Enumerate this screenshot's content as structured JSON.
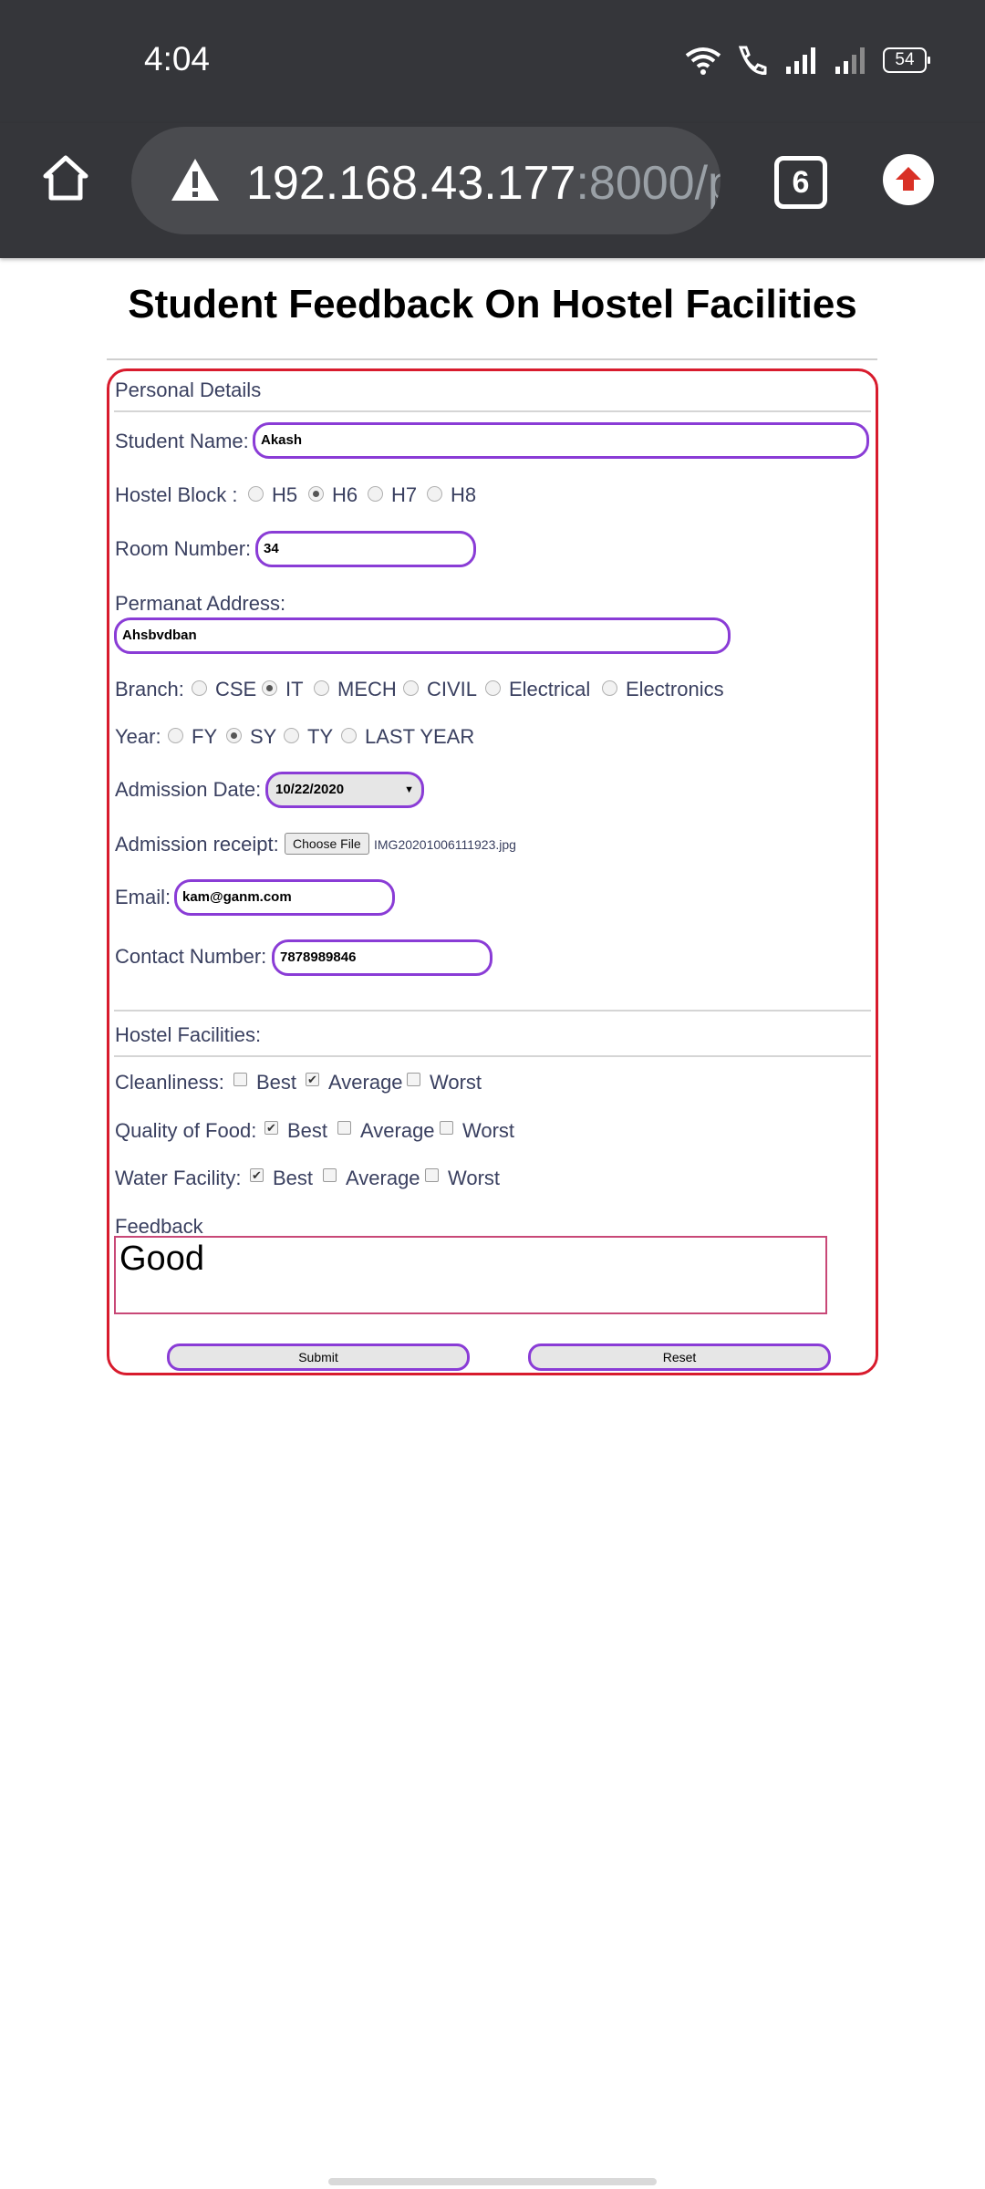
{
  "status": {
    "time": "4:04",
    "battery": "54"
  },
  "browser": {
    "url_main": "192.168.43.177",
    "url_dim": ":8000/p",
    "tab_count": "6"
  },
  "page": {
    "title": "Student Feedback On Hostel Facilities"
  },
  "personal": {
    "section_label": "Personal Details",
    "student_name_label": "Student Name:",
    "student_name_value": "Akash",
    "hostel_block_label": "Hostel Block :",
    "hostel_blocks": [
      "H5",
      "H6",
      "H7",
      "H8"
    ],
    "hostel_selected": "H6",
    "room_label": "Room Number:",
    "room_value": "34",
    "address_label": "Permanat Address:",
    "address_value": "Ahsbvdban",
    "branch_label": "Branch:",
    "branches": [
      "CSE",
      "IT",
      "MECH",
      "CIVIL",
      "Electrical",
      "Electronics"
    ],
    "branch_selected": "IT",
    "year_label": "Year:",
    "years": [
      "FY",
      "SY",
      "TY",
      "LAST YEAR"
    ],
    "year_selected": "SY",
    "admission_date_label": "Admission Date:",
    "admission_date_value": "10/22/2020",
    "receipt_label": "Admission receipt:",
    "choose_file_label": "Choose File",
    "receipt_file": "IMG20201006111923.jpg",
    "email_label": "Email:",
    "email_value": "kam@ganm.com",
    "contact_label": "Contact Number:",
    "contact_value": "7878989846"
  },
  "facilities": {
    "section_label": "Hostel Facilities:",
    "cleanliness_label": "Cleanliness:",
    "food_label": "Quality of Food:",
    "water_label": "Water Facility:",
    "options": [
      "Best",
      "Average",
      "Worst"
    ],
    "cleanliness_checked": "Average",
    "food_checked": "Best",
    "water_checked": "Best",
    "feedback_label": "Feedback",
    "feedback_value": "Good"
  },
  "buttons": {
    "submit": "Submit",
    "reset": "Reset"
  }
}
